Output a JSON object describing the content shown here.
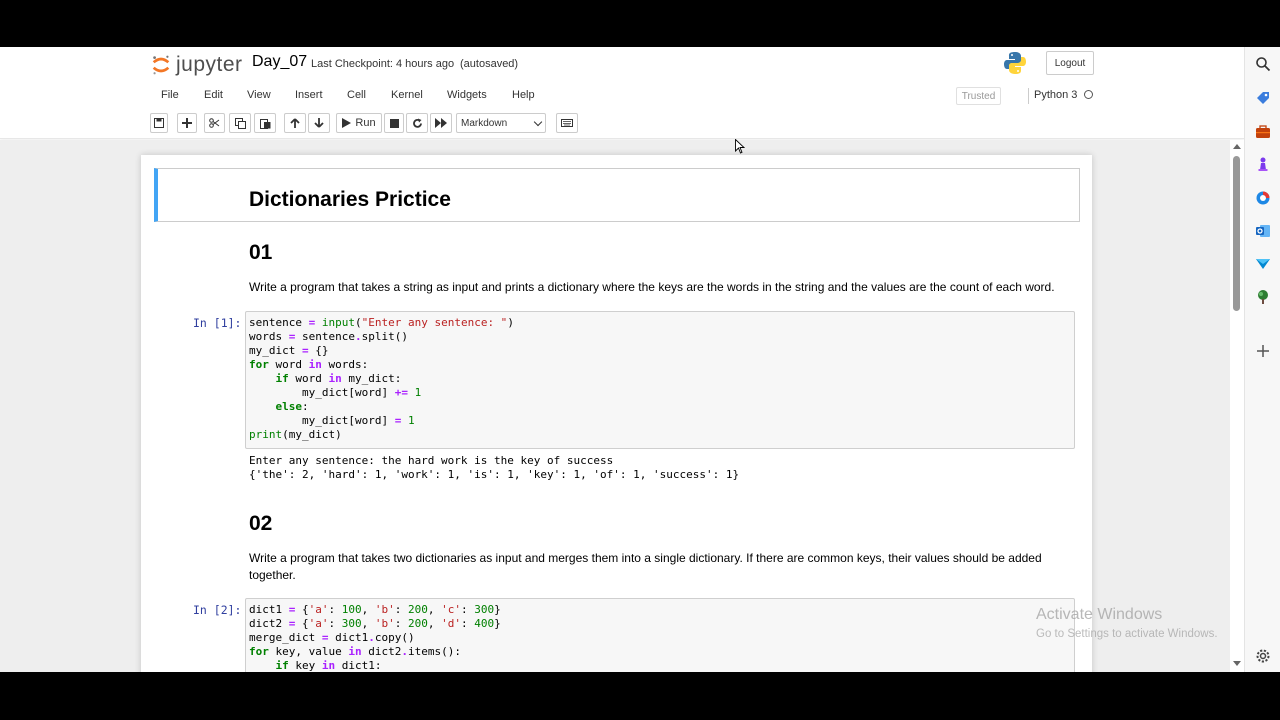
{
  "header": {
    "logo_text": "jupyter",
    "notebook_name": "Day_07",
    "checkpoint": "Last Checkpoint: 4 hours ago",
    "autosave": "(autosaved)",
    "logout_label": "Logout"
  },
  "menubar": {
    "items": [
      "File",
      "Edit",
      "View",
      "Insert",
      "Cell",
      "Kernel",
      "Widgets",
      "Help"
    ],
    "trusted": "Trusted",
    "kernel": "Python 3"
  },
  "toolbar": {
    "run_label": "Run",
    "cell_type": "Markdown"
  },
  "notebook": {
    "title": "Dictionaries Prictice",
    "section1": {
      "heading": "01",
      "description": "Write a program that takes a string as input and prints a dictionary where the keys are the words in the string and the values are the count of each word.",
      "prompt": "In [1]:",
      "output": [
        "Enter any sentence: the hard work is the key of success",
        "{'the': 2, 'hard': 1, 'work': 1, 'is': 1, 'key': 1, 'of': 1, 'success': 1}"
      ]
    },
    "section2": {
      "heading": "02",
      "description_line1": "Write a program that takes two dictionaries as input and merges them into a single dictionary. If there are common keys, their values should be added",
      "description_line2": "together.",
      "prompt": "In [2]:"
    }
  },
  "watermark": {
    "title": "Activate Windows",
    "subtitle": "Go to Settings to activate Windows."
  },
  "colors": {
    "selected_cell_bar": "#42a5f5",
    "prompt_blue": "#303f9f",
    "keyword_green": "#008000",
    "string_red": "#ba2121"
  },
  "edge_icons": [
    "search-icon",
    "tag-icon",
    "briefcase-icon",
    "chess-icon",
    "office-icon",
    "outlook-icon",
    "send-icon",
    "tree-icon",
    "plus-icon",
    "settings-icon"
  ]
}
